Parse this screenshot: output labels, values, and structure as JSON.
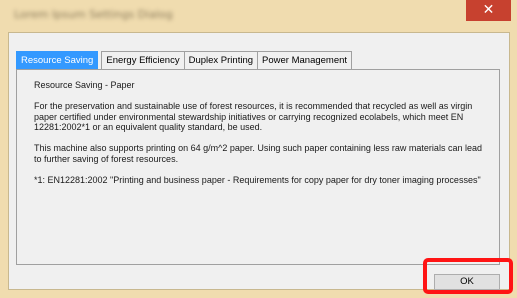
{
  "window": {
    "title": "Lorem Ipsum Settings Dialog",
    "close_glyph": "✕"
  },
  "tabs": [
    {
      "label": "Resource Saving",
      "active": true
    },
    {
      "label": "Energy Efficiency",
      "active": false
    },
    {
      "label": "Duplex Printing",
      "active": false
    },
    {
      "label": "Power Management",
      "active": false
    }
  ],
  "content": {
    "heading": "Resource Saving - Paper",
    "para1": "For the preservation and sustainable use of forest resources, it is recommended that recycled as well as virgin paper certified under environmental stewardship initiatives or carrying  recognized ecolabels, which meet EN 12281:2002*1 or an equivalent quality standard, be used.",
    "para2": "This machine also supports printing on 64 g/m^2 paper.  Using such paper containing less raw materials can lead to further saving of forest resources.",
    "para3": "*1: EN12281:2002 \"Printing and business paper - Requirements for copy paper for dry toner imaging processes\""
  },
  "buttons": {
    "ok_label": "OK"
  },
  "colors": {
    "title_bar": "#f0dcaf",
    "close_button": "#c7412f",
    "active_tab": "#3399ff",
    "highlight": "#ff1414"
  }
}
